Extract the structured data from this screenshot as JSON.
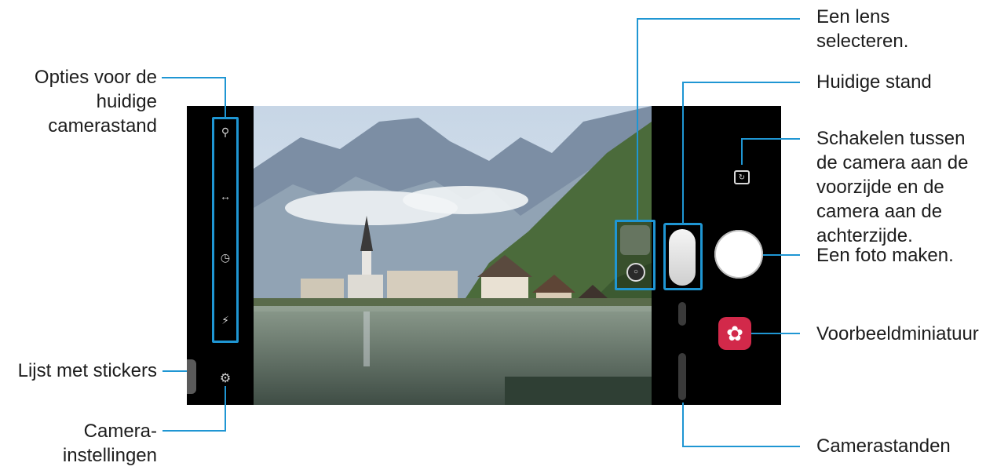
{
  "labels": {
    "options": [
      "Opties voor de",
      "huidige",
      "camerastand"
    ],
    "stickers": "Lijst met stickers",
    "settings": [
      "Camera-",
      "instellingen"
    ],
    "lens": [
      "Een lens",
      "selecteren."
    ],
    "current_mode": "Huidige stand",
    "switch": [
      "Schakelen tussen",
      "de camera aan de",
      "voorzijde en de",
      "camera aan de",
      "achterzijde."
    ],
    "take_photo": "Een foto maken.",
    "preview": "Voorbeeldminiatuur",
    "modes": "Camerastanden"
  },
  "icons": {
    "option_icons": [
      "search-icon",
      "scene-optimizer-icon",
      "timer-icon",
      "flash-icon"
    ],
    "settings": "gear-icon",
    "switch_camera": "switch-camera-icon",
    "preview": "flower-icon",
    "lens_dial": "lens-icon"
  },
  "colors": {
    "callout": "#1f96d3",
    "preview_thumbnail": "#d2294a"
  }
}
